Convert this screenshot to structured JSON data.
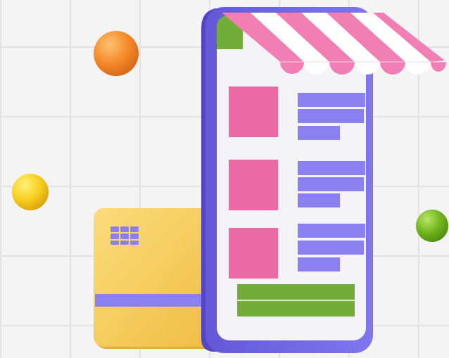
{
  "illustration": {
    "subject": "mobile-shop-storefront",
    "colors": {
      "background": "#f4f4f5",
      "grid": "#e2e2e4",
      "phone_frame": "#7468e6",
      "phone_screen": "#f3f3f8",
      "product_image": "#ec6aa3",
      "product_text": "#8a80ef",
      "buy_button": "#72ad3a",
      "awning_stripe": "#f27fb4",
      "awning_white": "#ffffff",
      "card": "#f6cd5a",
      "card_stripe": "#8a80ef",
      "ball_orange": "#f58b2a",
      "ball_yellow": "#f8cf20",
      "ball_green": "#72b51d"
    },
    "products": [
      {
        "name": "product-1"
      },
      {
        "name": "product-2"
      },
      {
        "name": "product-3"
      }
    ]
  }
}
